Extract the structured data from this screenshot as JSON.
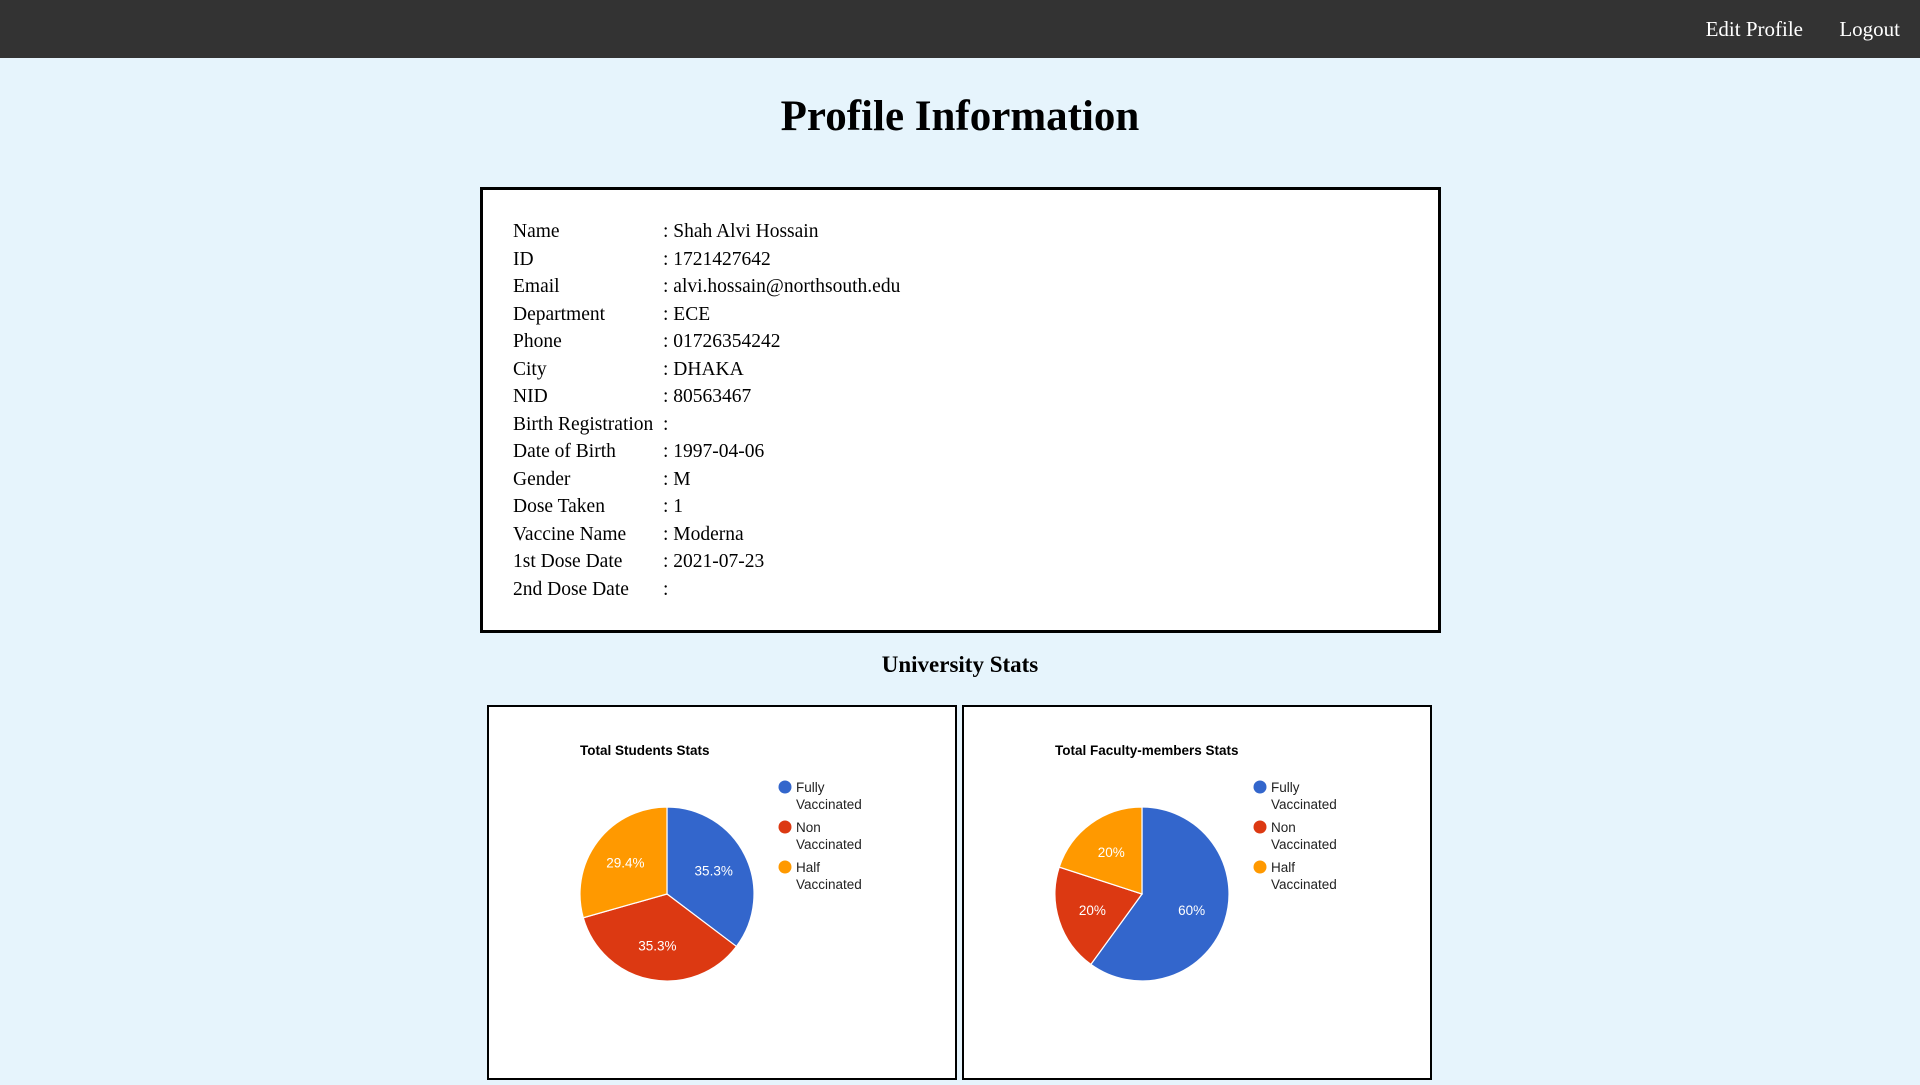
{
  "nav": {
    "edit_profile": "Edit Profile",
    "logout": "Logout"
  },
  "page_title": "Profile Information",
  "profile": {
    "fields": [
      {
        "label": "Name",
        "value": ": Shah Alvi Hossain"
      },
      {
        "label": "ID",
        "value": ": 1721427642"
      },
      {
        "label": "Email",
        "value": ": alvi.hossain@northsouth.edu"
      },
      {
        "label": "Department",
        "value": ": ECE"
      },
      {
        "label": "Phone",
        "value": ": 01726354242"
      },
      {
        "label": "City",
        "value": ": DHAKA"
      },
      {
        "label": "NID",
        "value": ": 80563467"
      },
      {
        "label": "Birth Registration",
        "value": ":"
      },
      {
        "label": "Date of Birth",
        "value": ": 1997-04-06"
      },
      {
        "label": "Gender",
        "value": ": M"
      },
      {
        "label": "Dose Taken",
        "value": ": 1"
      },
      {
        "label": "Vaccine Name",
        "value": ": Moderna"
      },
      {
        "label": "1st Dose Date",
        "value": ": 2021-07-23"
      },
      {
        "label": "2nd Dose Date",
        "value": ":"
      }
    ]
  },
  "stats_title": "University Stats",
  "colors": {
    "fully": "#3366cc",
    "non": "#dc3912",
    "half": "#ff9900",
    "topbar": "#333333",
    "page_bg": "#e6f4fc"
  },
  "chart_data": [
    {
      "type": "pie",
      "title": "Total Students Stats",
      "legend_position": "right",
      "slices": [
        {
          "name": "Fully Vaccinated",
          "legend_lines": [
            "Fully",
            "Vaccinated"
          ],
          "percent": 35.3,
          "label": "35.3%",
          "color": "#3366cc"
        },
        {
          "name": "Non Vaccinated",
          "legend_lines": [
            "Non",
            "Vaccinated"
          ],
          "percent": 35.3,
          "label": "35.3%",
          "color": "#dc3912"
        },
        {
          "name": "Half Vaccinated",
          "legend_lines": [
            "Half",
            "Vaccinated"
          ],
          "percent": 29.4,
          "label": "29.4%",
          "color": "#ff9900"
        }
      ]
    },
    {
      "type": "pie",
      "title": "Total Faculty-members Stats",
      "legend_position": "right",
      "slices": [
        {
          "name": "Fully Vaccinated",
          "legend_lines": [
            "Fully",
            "Vaccinated"
          ],
          "percent": 60,
          "label": "60%",
          "color": "#3366cc"
        },
        {
          "name": "Non Vaccinated",
          "legend_lines": [
            "Non",
            "Vaccinated"
          ],
          "percent": 20,
          "label": "20%",
          "color": "#dc3912"
        },
        {
          "name": "Half Vaccinated",
          "legend_lines": [
            "Half",
            "Vaccinated"
          ],
          "percent": 20,
          "label": "20%",
          "color": "#ff9900"
        }
      ]
    }
  ]
}
